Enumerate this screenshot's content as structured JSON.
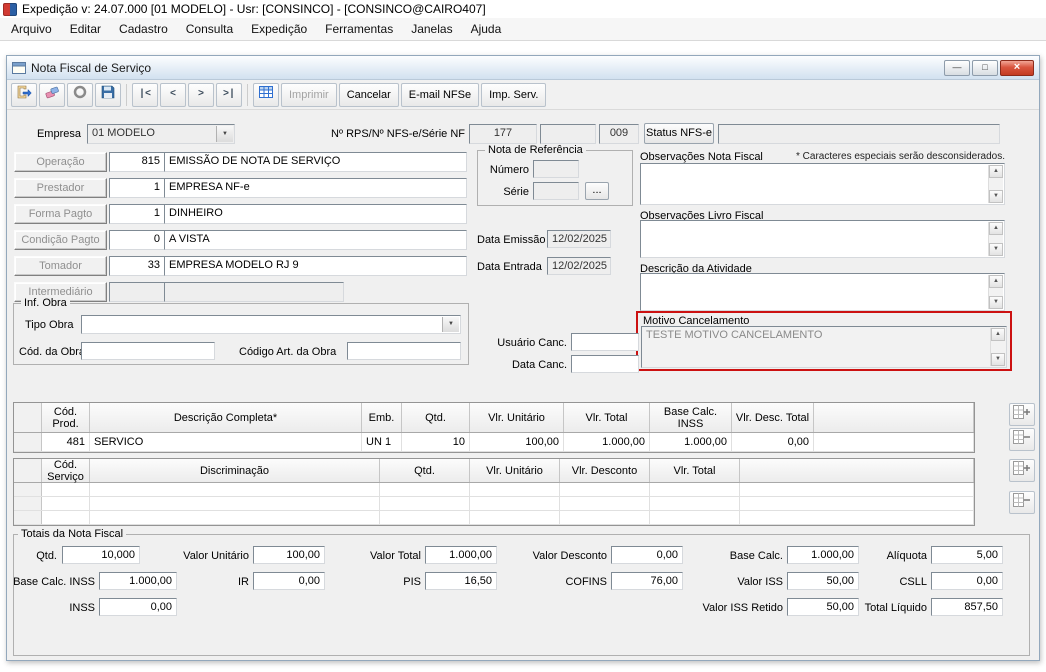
{
  "app": {
    "title": "Expedição  v: 24.07.000  [01 MODELO] - Usr: [CONSINCO] - [CONSINCO@CAIRO407]",
    "menu": [
      "Arquivo",
      "Editar",
      "Cadastro",
      "Consulta",
      "Expedição",
      "Ferramentas",
      "Janelas",
      "Ajuda"
    ]
  },
  "window": {
    "title": "Nota Fiscal de Serviço",
    "controls": {
      "minimize": "—",
      "maximize": "□",
      "close": "×"
    }
  },
  "toolbar": {
    "nav_first": "|<",
    "nav_prev": "<",
    "nav_next": ">",
    "nav_last": ">|",
    "imprimir": "Imprimir",
    "cancelar": "Cancelar",
    "email_nfse": "E-mail NFSe",
    "imp_serv": "Imp. Serv."
  },
  "icons": {
    "dropdown": "▼",
    "scroll_up": "▲",
    "scroll_down": "▼"
  },
  "form": {
    "empresa_label": "Empresa",
    "empresa_value": "01 MODELO",
    "rps_label": "Nº RPS/Nº NFS-e/Série NF",
    "rps_value": "177",
    "nfse_value": "",
    "serie_nf_value": "009",
    "status_nfse_label": "Status NFS-e",
    "status_nfse_value": "",
    "operacao": {
      "label": "Operação",
      "code": "815",
      "desc": "EMISSÃO DE NOTA DE SERVIÇO"
    },
    "prestador": {
      "label": "Prestador",
      "code": "1",
      "desc": "EMPRESA NF-e"
    },
    "forma_pagto": {
      "label": "Forma Pagto",
      "code": "1",
      "desc": "DINHEIRO"
    },
    "condicao_pagto": {
      "label": "Condição Pagto",
      "code": "0",
      "desc": "A VISTA"
    },
    "tomador": {
      "label": "Tomador",
      "code": "33",
      "desc": "EMPRESA MODELO RJ 9"
    },
    "intermediario": {
      "label": "Intermediário",
      "code": "",
      "desc": ""
    },
    "nota_referencia": {
      "title": "Nota de Referência",
      "numero_label": "Número",
      "numero_value": "",
      "serie_label": "Série",
      "serie_value": "",
      "browse_label": "..."
    },
    "data_emissao_label": "Data Emissão",
    "data_emissao_value": "12/02/2025",
    "data_entrada_label": "Data Entrada",
    "data_entrada_value": "12/02/2025",
    "obs_nota_fiscal_label": "Observações Nota Fiscal",
    "obs_nota_fiscal_hint": "* Caracteres especiais serão desconsiderados.",
    "obs_nota_fiscal_value": "",
    "obs_livro_fiscal_label": "Observações Livro Fiscal",
    "obs_livro_fiscal_value": "",
    "descricao_atividade_label": "Descrição da Atividade",
    "descricao_atividade_value": "",
    "motivo_cancelamento_label": "Motivo Cancelamento",
    "motivo_cancelamento_value": "TESTE MOTIVO CANCELAMENTO",
    "inf_obra_title": "Inf. Obra",
    "tipo_obra_label": "Tipo Obra",
    "tipo_obra_value": "",
    "cod_obra_label": "Cód. da Obra",
    "cod_obra_value": "",
    "cod_art_obra_label": "Código Art. da Obra",
    "cod_art_obra_value": "",
    "usuario_canc_label": "Usuário Canc.",
    "usuario_canc_value": "",
    "data_canc_label": "Data Canc.",
    "data_canc_value": ""
  },
  "product_grid": {
    "headers": {
      "cod": "Cód. Prod.",
      "desc": "Descrição Completa*",
      "emb": "Emb.",
      "qtd": "Qtd.",
      "vlr_unitario": "Vlr. Unitário",
      "vlr_total": "Vlr. Total",
      "base_calc_inss": "Base Calc. INSS",
      "vlr_desc_total": "Vlr. Desc. Total"
    },
    "rows": [
      {
        "cod": "481",
        "desc": "SERVICO",
        "emb": "UN 1",
        "qtd": "10",
        "vlr_unitario": "100,00",
        "vlr_total": "1.000,00",
        "base_calc_inss": "1.000,00",
        "vlr_desc_total": "0,00"
      }
    ]
  },
  "service_grid": {
    "headers": {
      "cod": "Cód. Serviço",
      "disc": "Discriminação",
      "qtd": "Qtd.",
      "vlr_unitario": "Vlr. Unitário",
      "vlr_desconto": "Vlr. Desconto",
      "vlr_total": "Vlr. Total"
    }
  },
  "totals": {
    "title": "Totais da Nota Fiscal",
    "qtd": {
      "label": "Qtd.",
      "value": "10,000"
    },
    "valor_unitario": {
      "label": "Valor Unitário",
      "value": "100,00"
    },
    "valor_total": {
      "label": "Valor Total",
      "value": "1.000,00"
    },
    "valor_desconto": {
      "label": "Valor Desconto",
      "value": "0,00"
    },
    "base_calc": {
      "label": "Base Calc.",
      "value": "1.000,00"
    },
    "aliquota": {
      "label": "Alíquota",
      "value": "5,00"
    },
    "base_calc_inss": {
      "label": "Base Calc. INSS",
      "value": "1.000,00"
    },
    "ir": {
      "label": "IR",
      "value": "0,00"
    },
    "pis": {
      "label": "PIS",
      "value": "16,50"
    },
    "cofins": {
      "label": "COFINS",
      "value": "76,00"
    },
    "valor_iss": {
      "label": "Valor ISS",
      "value": "50,00"
    },
    "csll": {
      "label": "CSLL",
      "value": "0,00"
    },
    "inss": {
      "label": "INSS",
      "value": "0,00"
    },
    "valor_iss_retido": {
      "label": "Valor ISS Retido",
      "value": "50,00"
    },
    "total_liquido": {
      "label": "Total Líquido",
      "value": "857,50"
    }
  }
}
